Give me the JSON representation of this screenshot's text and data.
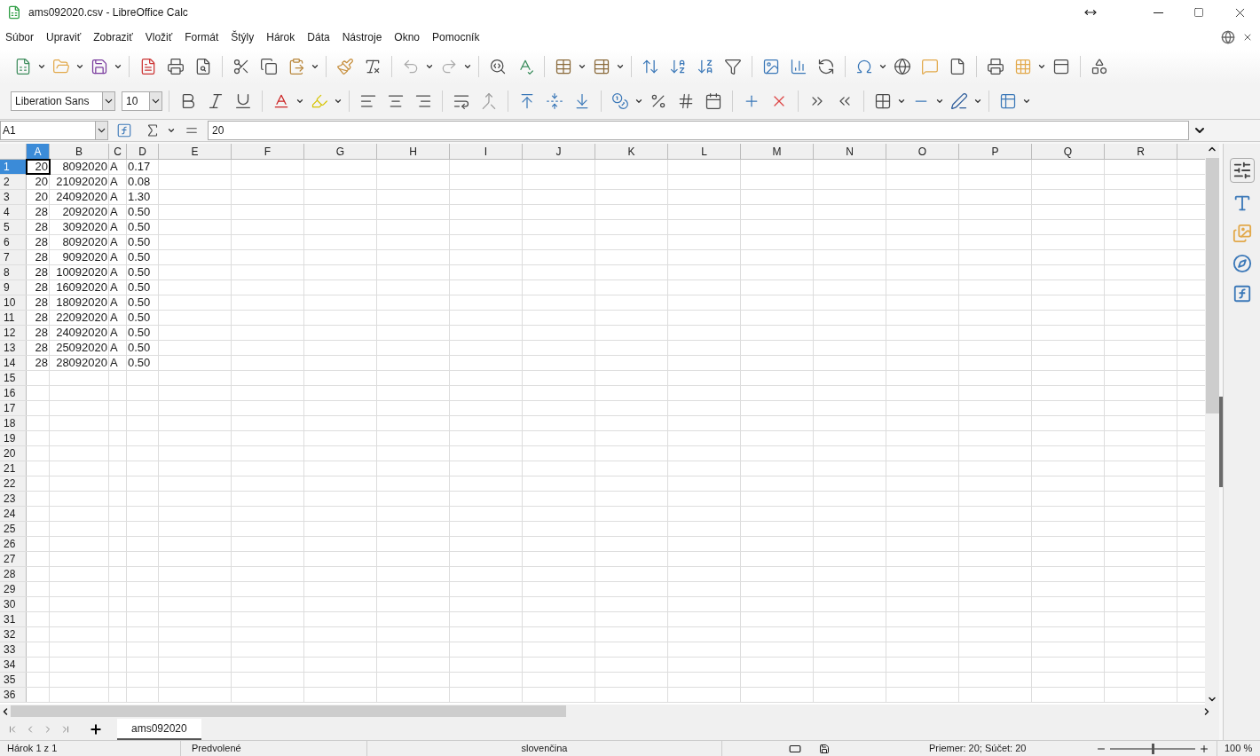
{
  "window": {
    "title": "ams092020.csv - LibreOffice Calc"
  },
  "menu": [
    "Súbor",
    "Upraviť",
    "Zobraziť",
    "Vložiť",
    "Formát",
    "Štýly",
    "Hárok",
    "Dáta",
    "Nástroje",
    "Okno",
    "Pomocník"
  ],
  "format_toolbar": {
    "font_name": "Liberation Sans",
    "font_size": "10"
  },
  "formula_bar": {
    "name_box": "A1",
    "value": "20"
  },
  "columns": [
    {
      "label": "A",
      "selected": true
    },
    {
      "label": "B",
      "selected": false
    },
    {
      "label": "C",
      "selected": false
    },
    {
      "label": "D",
      "selected": false
    },
    {
      "label": "E",
      "selected": false
    },
    {
      "label": "F",
      "selected": false
    },
    {
      "label": "G",
      "selected": false
    },
    {
      "label": "H",
      "selected": false
    },
    {
      "label": "I",
      "selected": false
    },
    {
      "label": "J",
      "selected": false
    },
    {
      "label": "K",
      "selected": false
    },
    {
      "label": "L",
      "selected": false
    },
    {
      "label": "M",
      "selected": false
    },
    {
      "label": "N",
      "selected": false
    },
    {
      "label": "O",
      "selected": false
    },
    {
      "label": "P",
      "selected": false
    },
    {
      "label": "Q",
      "selected": false
    },
    {
      "label": "R",
      "selected": false
    }
  ],
  "rows": [
    {
      "label": "1",
      "selected": true,
      "cells": [
        "20",
        "8092020",
        "A",
        "0.17"
      ]
    },
    {
      "label": "2",
      "selected": false,
      "cells": [
        "20",
        "21092020",
        "A",
        "0.08"
      ]
    },
    {
      "label": "3",
      "selected": false,
      "cells": [
        "20",
        "24092020",
        "A",
        "1.30"
      ]
    },
    {
      "label": "4",
      "selected": false,
      "cells": [
        "28",
        "2092020",
        "A",
        "0.50"
      ]
    },
    {
      "label": "5",
      "selected": false,
      "cells": [
        "28",
        "3092020",
        "A",
        "0.50"
      ]
    },
    {
      "label": "6",
      "selected": false,
      "cells": [
        "28",
        "8092020",
        "A",
        "0.50"
      ]
    },
    {
      "label": "7",
      "selected": false,
      "cells": [
        "28",
        "9092020",
        "A",
        "0.50"
      ]
    },
    {
      "label": "8",
      "selected": false,
      "cells": [
        "28",
        "10092020",
        "A",
        "0.50"
      ]
    },
    {
      "label": "9",
      "selected": false,
      "cells": [
        "28",
        "16092020",
        "A",
        "0.50"
      ]
    },
    {
      "label": "10",
      "selected": false,
      "cells": [
        "28",
        "18092020",
        "A",
        "0.50"
      ]
    },
    {
      "label": "11",
      "selected": false,
      "cells": [
        "28",
        "22092020",
        "A",
        "0.50"
      ]
    },
    {
      "label": "12",
      "selected": false,
      "cells": [
        "28",
        "24092020",
        "A",
        "0.50"
      ]
    },
    {
      "label": "13",
      "selected": false,
      "cells": [
        "28",
        "25092020",
        "A",
        "0.50"
      ]
    },
    {
      "label": "14",
      "selected": false,
      "cells": [
        "28",
        "28092020",
        "A",
        "0.50"
      ]
    },
    {
      "label": "15",
      "selected": false
    },
    {
      "label": "16",
      "selected": false
    },
    {
      "label": "17",
      "selected": false
    },
    {
      "label": "18",
      "selected": false
    },
    {
      "label": "19",
      "selected": false
    },
    {
      "label": "20",
      "selected": false
    },
    {
      "label": "21",
      "selected": false
    },
    {
      "label": "22",
      "selected": false
    },
    {
      "label": "23",
      "selected": false
    },
    {
      "label": "24",
      "selected": false
    },
    {
      "label": "25",
      "selected": false
    },
    {
      "label": "26",
      "selected": false
    },
    {
      "label": "27",
      "selected": false
    },
    {
      "label": "28",
      "selected": false
    },
    {
      "label": "29",
      "selected": false
    },
    {
      "label": "30",
      "selected": false
    },
    {
      "label": "31",
      "selected": false
    },
    {
      "label": "32",
      "selected": false
    },
    {
      "label": "33",
      "selected": false
    },
    {
      "label": "34",
      "selected": false
    },
    {
      "label": "35",
      "selected": false
    },
    {
      "label": "36",
      "selected": false
    }
  ],
  "sheet_tabs": [
    {
      "label": "ams092020",
      "selected": true
    }
  ],
  "status_bar": {
    "sheet": "Hárok 1 z 1",
    "style": "Predvolené",
    "language": "slovenčina",
    "summary": "Priemer: 20; Súčet: 20",
    "zoom_slider": {
      "level": 0.5
    },
    "zoom": "100 %"
  }
}
